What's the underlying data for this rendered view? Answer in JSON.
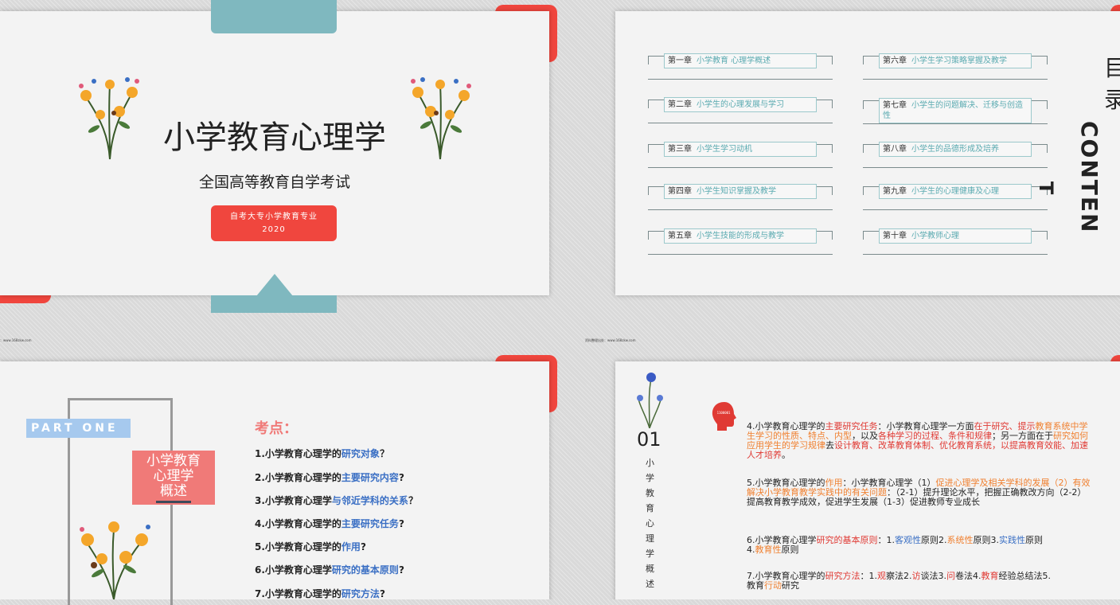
{
  "slide1": {
    "title": "小学教育心理学",
    "subtitle": "全国高等教育自学考试",
    "button_line1": "自考大专小学教育专业",
    "button_line2": "2020"
  },
  "slide2": {
    "title_char1": "目",
    "title_char2": "录",
    "contents_word": "CONTEN",
    "contents_tail": "T",
    "chapters": [
      {
        "ch": "第一章",
        "name": "小学教育 心理学概述"
      },
      {
        "ch": "第二章",
        "name": "小学生的心理发展与学习"
      },
      {
        "ch": "第三章",
        "name": "小学生学习动机"
      },
      {
        "ch": "第四章",
        "name": "小学生知识掌握及教学"
      },
      {
        "ch": "第五章",
        "name": "小学生技能的形成与教学"
      },
      {
        "ch": "第六章",
        "name": "小学生学习策略掌握及教学"
      },
      {
        "ch": "第七章",
        "name": "小学生的问题解决、迁移与创造性"
      },
      {
        "ch": "第八章",
        "name": "小学生的品德形成及培养"
      },
      {
        "ch": "第九章",
        "name": "小学生的心理健康及心理"
      },
      {
        "ch": "第十章",
        "name": "小学教师心理"
      }
    ]
  },
  "watermark_left": "：www.168zkw.com",
  "watermark_right": "资料整理出处：www.168zkw.com",
  "slide3": {
    "part": "PART ONE",
    "pink_line1": "小学教育",
    "pink_line2": "心理学",
    "pink_line3": "概述",
    "kaodian": "考点：",
    "questions": [
      {
        "pre": "1.小学教育心理学的",
        "hl": "研究对象",
        "post": "？"
      },
      {
        "pre": "2.小学教育心理学的",
        "hl": "主要研究内容",
        "post": "?"
      },
      {
        "pre": "3.小学教育心理学",
        "hl": "与邻近学科的关系",
        "post": "？"
      },
      {
        "pre": "4.小学教育心理学的",
        "hl": "主要研究任务",
        "post": "?"
      },
      {
        "pre": "5.小学教育心理学的",
        "hl": "作用",
        "post": "?"
      },
      {
        "pre": "6.小学教育心理学",
        "hl": "研究的基本原则",
        "post": "?"
      },
      {
        "pre": "7.小学教育心理学的",
        "hl": "研究方法",
        "post": "?"
      }
    ]
  },
  "slide4": {
    "number": "01",
    "vertical": [
      "小",
      "学",
      "教",
      "育",
      "心",
      "理",
      "学",
      "概",
      "述"
    ],
    "p4": {
      "a": "4.小学教育心理学的",
      "b": "主要研究任务",
      "c": "：小学教育心理学一方面",
      "d": "在于研究、提示",
      "e": "教育系统中学生学习的性质、特点、内型",
      "f": "，以及",
      "g": "各种学习的过程、条件和规",
      "h": "律",
      "i": "；另一方面在于",
      "j": "研究如何应用学生的学习规律",
      "k": "去",
      "l": "设计教育、改革教育体制、",
      "m": "优化教育系统，以提高教育效能、加速人才培养",
      "n": "。"
    },
    "p5": {
      "a": "5.小学教育心理学的",
      "b": "作用",
      "c": "：小学教育心理学（1）",
      "d": "促进心理学及相关学科的发",
      "e": "展（2）有效解决小学教育教学实践中的有关问题",
      "f": "：（2-1）提升理论水平，",
      "g": "把握正确教改方向（2-2）提高教育教学成效，促进学生发展（1-3）促进教",
      "h": "师专业成长"
    },
    "p6": {
      "a": "6.小学教育心理学",
      "b": "研究的基本原则",
      "c": "：1.",
      "d": "客观性",
      "e": "原则2.",
      "f": "系统性",
      "g": "原则3.",
      "h": "实践性",
      "i": "原则",
      "j": "4.",
      "k": "教育性",
      "l": "原则"
    },
    "p7": {
      "a": "7.小学教育心理学的",
      "b": "研究方法",
      "c": "：1.",
      "d": "观",
      "e": "察法2.",
      "f": "访",
      "g": "谈法3.",
      "h": "问",
      "i": "卷法4.",
      "j": "教育",
      "k": "经验总结法5.",
      "l": "教育",
      "m": "行动",
      "n": "研究"
    }
  }
}
